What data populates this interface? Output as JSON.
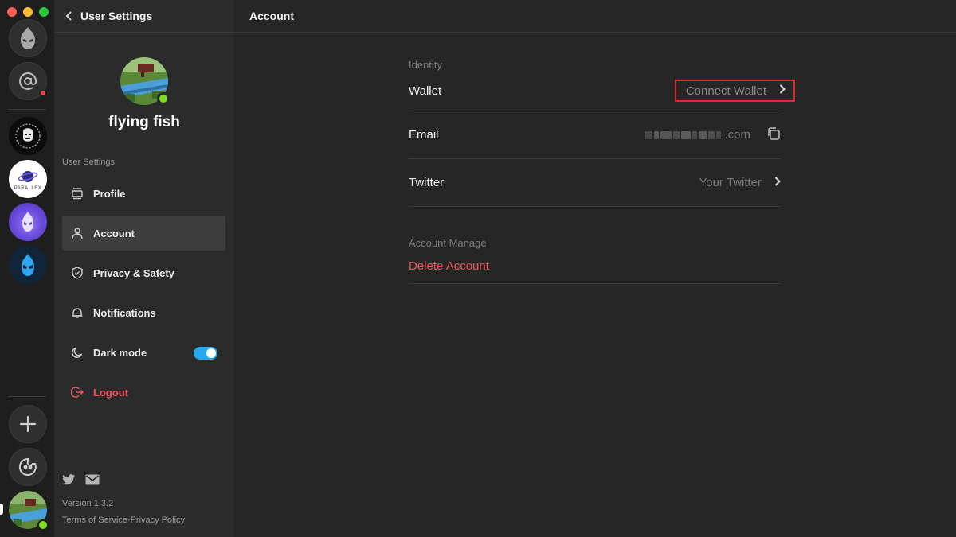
{
  "window": {
    "traffic_lights": [
      "close",
      "minimize",
      "zoom"
    ]
  },
  "rail": {
    "servers": [
      {
        "name": "app-logo-icon"
      },
      {
        "name": "mentions-icon",
        "badge": true
      },
      {
        "name": "bored-ape-server"
      },
      {
        "name": "parallax-server",
        "text": "PARALLEX"
      },
      {
        "name": "purple-flame-server"
      },
      {
        "name": "blue-flame-server"
      }
    ],
    "add_server": "add-server-icon",
    "explore": "explore-icon"
  },
  "sidebar": {
    "header_title": "User Settings",
    "username": "flying fish",
    "section_label": "User Settings",
    "items": [
      {
        "label": "Profile",
        "icon": "profile-card-icon"
      },
      {
        "label": "Account",
        "icon": "person-icon",
        "active": true
      },
      {
        "label": "Privacy & Safety",
        "icon": "shield-icon"
      },
      {
        "label": "Notifications",
        "icon": "bell-icon"
      },
      {
        "label": "Dark mode",
        "icon": "moon-icon",
        "toggle_on": true
      },
      {
        "label": "Logout",
        "icon": "logout-icon"
      }
    ],
    "footer": {
      "version": "Version 1.3.2",
      "terms": "Terms of Service",
      "separator": "·",
      "privacy": "Privacy Policy"
    }
  },
  "main": {
    "title": "Account",
    "identity_label": "Identity",
    "rows": {
      "wallet_label": "Wallet",
      "wallet_value": "Connect Wallet",
      "email_label": "Email",
      "email_suffix": ".com",
      "twitter_label": "Twitter",
      "twitter_value": "Your Twitter"
    },
    "manage_label": "Account Manage",
    "delete_label": "Delete Account"
  },
  "colors": {
    "accent_blue": "#26a9f0",
    "danger_red": "#f2555b",
    "online_green": "#7ddc1f",
    "highlight_red": "#e0282d"
  }
}
